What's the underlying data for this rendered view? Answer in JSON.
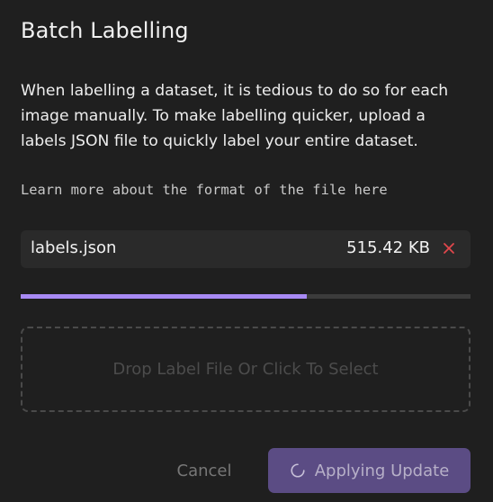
{
  "dialog": {
    "title": "Batch Labelling",
    "description": "When labelling a dataset, it is tedious to do so for each image manually. To make labelling quicker, upload a labels JSON file to quickly label your entire dataset.",
    "learn_more": "Learn more about the format of the file here"
  },
  "file": {
    "name": "labels.json",
    "size": "515.42 KB",
    "remove_icon": "close-icon",
    "remove_color": "#e0474c"
  },
  "upload": {
    "progress_fraction": 0.636,
    "accent_color": "#a88af4"
  },
  "dropzone": {
    "label": "Drop Label File Or Click To Select"
  },
  "footer": {
    "cancel_label": "Cancel",
    "apply_label": "Applying Update",
    "apply_icon": "spinner-icon"
  }
}
